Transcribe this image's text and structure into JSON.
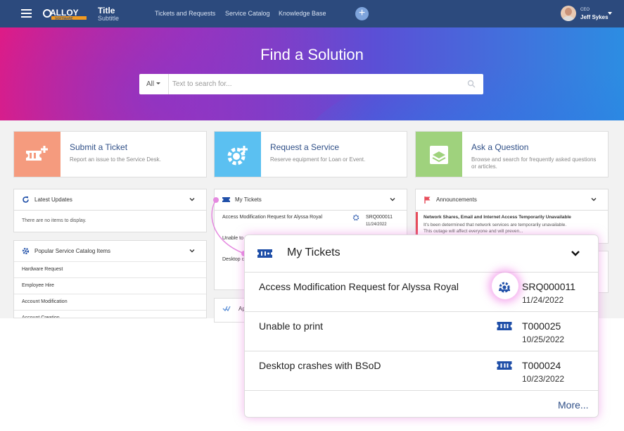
{
  "header": {
    "logo_text": "ALLOY SOFTWARE",
    "title": "Title",
    "subtitle": "Subtitle",
    "nav": [
      "Tickets and Requests",
      "Service Catalog",
      "Knowledge Base"
    ],
    "plus_label": "+",
    "user_role": "CEO",
    "user_name": "Jeff Sykes"
  },
  "hero": {
    "title": "Find a Solution",
    "search_scope": "All",
    "search_placeholder": "Text to search for..."
  },
  "actions": [
    {
      "title": "Submit a Ticket",
      "desc": "Report an issue to the Service Desk.",
      "color": "#f59b7e"
    },
    {
      "title": "Request a Service",
      "desc": "Reserve equipment for Loan or Event.",
      "color": "#5bc0f1"
    },
    {
      "title": "Ask a Question",
      "desc": "Browse and search for frequently asked questions or articles.",
      "color": "#9fd27d"
    }
  ],
  "latest_updates": {
    "title": "Latest Updates",
    "empty": "There are no items to display."
  },
  "popular": {
    "title": "Popular Service Catalog Items",
    "items": [
      "Hardware Request",
      "Employee Hire",
      "Account Modification",
      "Account Creation"
    ]
  },
  "my_tickets_small": {
    "title": "My Tickets",
    "row1_title": "Access Modification Request for Alyssa Royal",
    "row1_id": "SRQ000011",
    "row1_date": "11/24/2022",
    "row2_title": "Unable to",
    "row3_title": "Desktop c"
  },
  "approvals_small": {
    "title": "Ap"
  },
  "announcements": {
    "title": "Announcements",
    "item_title": "Network Shares, Email and Internet Access Temporarily Unavailable",
    "item_text1": "It's been determined that network services are temporarily unavailable.",
    "item_text2": "This outage will affect everyone and will preven..."
  },
  "my_tickets": {
    "title": "My Tickets",
    "rows": [
      {
        "title": "Access Modification Request for Alyssa Royal",
        "id": "SRQ000011",
        "date": "11/24/2022",
        "icon": "service-request-icon"
      },
      {
        "title": "Unable to print",
        "id": "T000025",
        "date": "10/25/2022",
        "icon": "ticket-icon"
      },
      {
        "title": "Desktop crashes with BSoD",
        "id": "T000024",
        "date": "10/23/2022",
        "icon": "ticket-icon"
      }
    ],
    "more_label": "More..."
  },
  "colors": {
    "header": "#2c4a7d",
    "accent": "#2f4f87",
    "icon_blue": "#1f4fa8",
    "highlight": "#e58ae0"
  }
}
